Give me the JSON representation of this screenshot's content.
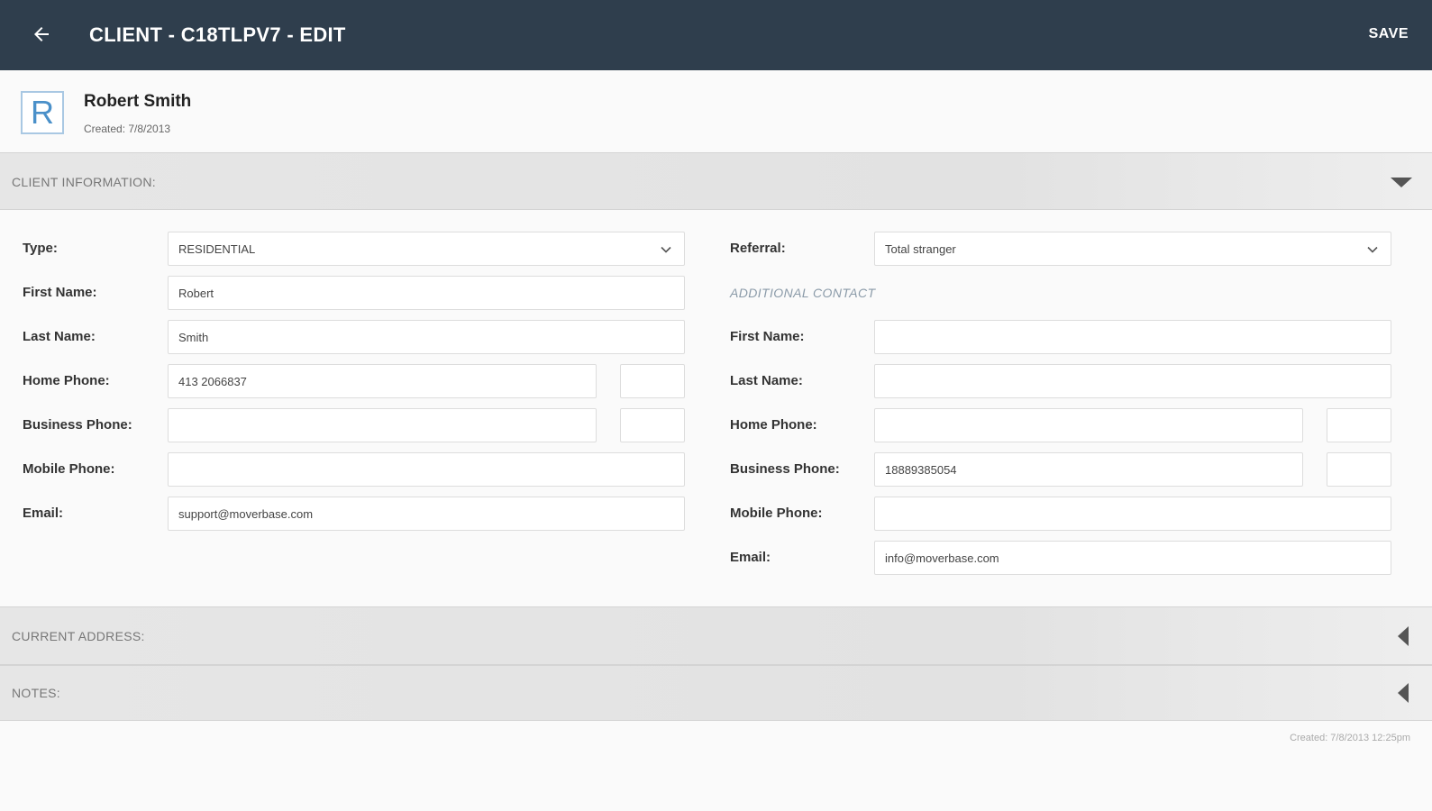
{
  "appbar": {
    "title": "CLIENT - C18TLPV7 - EDIT",
    "save_label": "SAVE",
    "back_icon": "arrow-left-icon",
    "color": "#2f3e4d"
  },
  "client": {
    "avatar_letter": "R",
    "name": "Robert Smith",
    "created": "Created: 7/8/2013"
  },
  "sections": {
    "client_information": "CLIENT INFORMATION:",
    "current_address": "CURRENT ADDRESS:",
    "notes": "NOTES:"
  },
  "left": {
    "type_label": "Type:",
    "type_value": "RESIDENTIAL",
    "first_name_label": "First Name:",
    "first_name_value": "Robert",
    "last_name_label": "Last Name:",
    "last_name_value": "Smith",
    "home_phone_label": "Home Phone:",
    "home_phone_value": "413 2066837",
    "home_phone_ext": "",
    "business_phone_label": "Business Phone:",
    "business_phone_value": "",
    "business_phone_ext": "",
    "mobile_phone_label": "Mobile Phone:",
    "mobile_phone_value": "",
    "email_label": "Email:",
    "email_value": "support@moverbase.com"
  },
  "right": {
    "referral_label": "Referral:",
    "referral_value": "Total stranger",
    "additional_contact": "ADDITIONAL CONTACT",
    "first_name_label": "First Name:",
    "first_name_value": "",
    "last_name_label": "Last Name:",
    "last_name_value": "",
    "home_phone_label": "Home Phone:",
    "home_phone_value": "",
    "home_phone_ext": "",
    "business_phone_label": "Business Phone:",
    "business_phone_value": "18889385054",
    "business_phone_ext": "",
    "mobile_phone_label": "Mobile Phone:",
    "mobile_phone_value": "",
    "email_label": "Email:",
    "email_value": "info@moverbase.com"
  },
  "footer": {
    "created": "Created: 7/8/2013 12:25pm"
  }
}
